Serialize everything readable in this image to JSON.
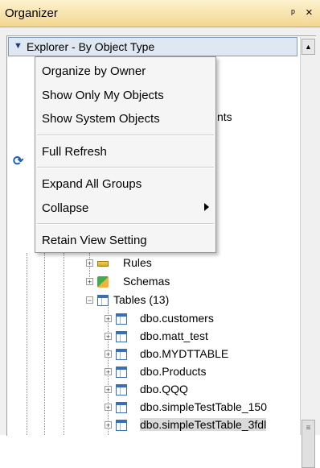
{
  "window": {
    "title": "Organizer",
    "pin_glyph": "ᵖ",
    "close_glyph": "×"
  },
  "tree_header": {
    "label": "Explorer - By Object Type"
  },
  "context_menu": {
    "items": [
      {
        "label": "Organize by Owner"
      },
      {
        "label": "Show Only My Objects"
      },
      {
        "label": "Show System Objects"
      },
      {
        "label": "Full Refresh"
      },
      {
        "label": "Expand All Groups"
      },
      {
        "label": "Collapse"
      },
      {
        "label": "Retain View Setting"
      }
    ]
  },
  "hidden_partial_text": "nts",
  "tree": {
    "nodes": [
      {
        "label": "Rules",
        "icon": "rules-icon",
        "expander": "+"
      },
      {
        "label": "Schemas",
        "icon": "schema-icon",
        "expander": "+"
      },
      {
        "label": "Tables (13)",
        "icon": "table-icon",
        "expander": "−"
      }
    ],
    "tables": [
      {
        "label": "dbo.customers",
        "icon": "table-icon",
        "expander": "+"
      },
      {
        "label": "dbo.matt_test",
        "icon": "table-icon",
        "expander": "+"
      },
      {
        "label": "dbo.MYDTTABLE",
        "icon": "table-icon",
        "expander": "+"
      },
      {
        "label": "dbo.Products",
        "icon": "table-icon",
        "expander": "+"
      },
      {
        "label": "dbo.QQQ",
        "icon": "table-icon",
        "expander": "+"
      },
      {
        "label": "dbo.simpleTestTable_150",
        "icon": "table-icon",
        "expander": "+"
      },
      {
        "label": "dbo.simpleTestTable_3fdl",
        "icon": "table-icon",
        "expander": "+"
      }
    ]
  }
}
